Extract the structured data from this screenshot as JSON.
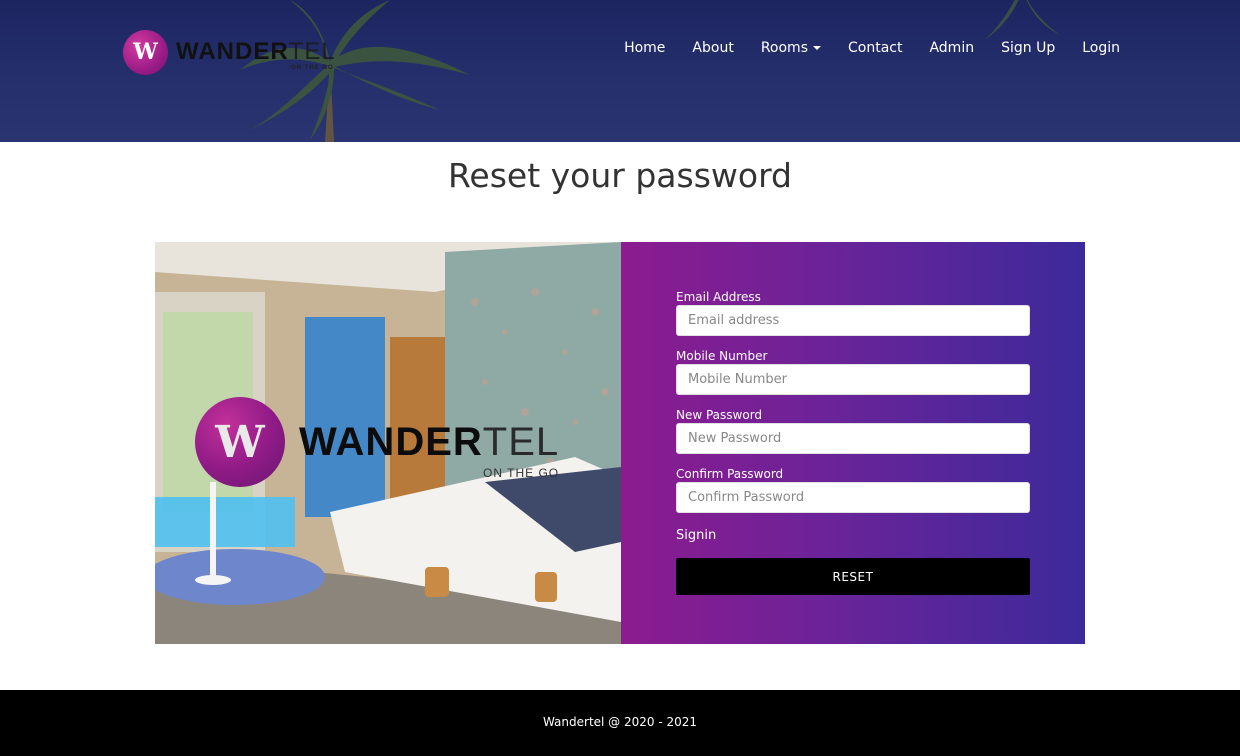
{
  "brand": {
    "logo_letter": "W",
    "name_main": "WANDER",
    "name_tail": "TEL",
    "tagline": "ON THE GO"
  },
  "nav": {
    "items": [
      {
        "label": "Home"
      },
      {
        "label": "About"
      },
      {
        "label": "Rooms"
      },
      {
        "label": "Contact"
      },
      {
        "label": "Admin"
      },
      {
        "label": "Sign Up"
      },
      {
        "label": "Login"
      }
    ]
  },
  "page": {
    "title": "Reset your password"
  },
  "form": {
    "email": {
      "label": "Email Address",
      "placeholder": "Email address",
      "value": ""
    },
    "mobile": {
      "label": "Mobile Number",
      "placeholder": "Mobile Number",
      "value": ""
    },
    "new_password": {
      "label": "New Password",
      "placeholder": "New Password",
      "value": ""
    },
    "confirm_password": {
      "label": "Confirm Password",
      "placeholder": "Confirm Password",
      "value": ""
    },
    "signin_link": "Signin",
    "reset_button": "RESET"
  },
  "footer": {
    "text": "Wandertel @ 2020 - 2021"
  },
  "colors": {
    "header_bg": "#242f6c",
    "form_gradient_start": "#8c1b8f",
    "form_gradient_end": "#3c2a9a",
    "button_bg": "#000000",
    "footer_bg": "#000000"
  }
}
